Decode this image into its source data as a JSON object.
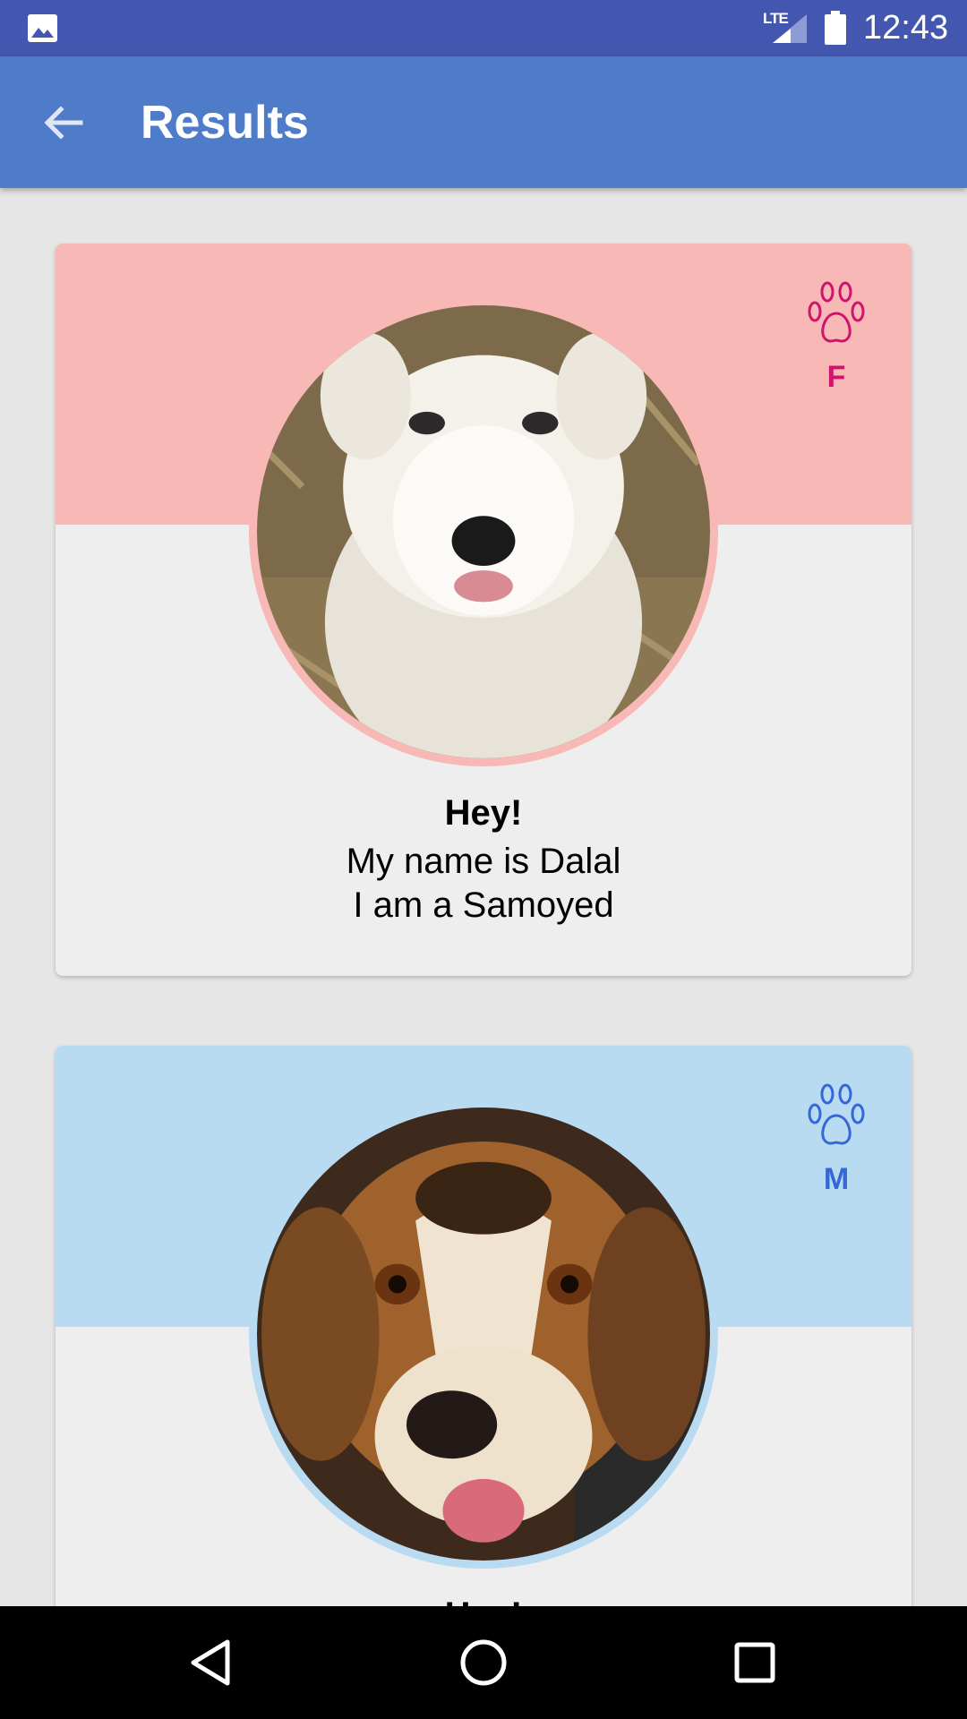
{
  "status_bar": {
    "network": "LTE",
    "time": "12:43",
    "icons": [
      "gallery-icon",
      "signal-icon",
      "battery-icon"
    ]
  },
  "app_bar": {
    "title": "Results",
    "back_icon": "arrow-back-icon"
  },
  "cards": [
    {
      "gender": "F",
      "greeting": "Hey!",
      "name_line": "My name is Dalal",
      "breed_line": "I am a Samoyed",
      "banner_color": "#f8b8b6",
      "accent_color": "#d0136c",
      "icon": "paw-icon"
    },
    {
      "gender": "M",
      "greeting": "Hey!",
      "banner_color": "#b9dbf2",
      "accent_color": "#3567d8",
      "icon": "paw-icon"
    }
  ],
  "nav_bar": {
    "icons": [
      "back-triangle-icon",
      "home-circle-icon",
      "recents-square-icon"
    ]
  },
  "colors": {
    "status_bar": "#4457b0",
    "app_bar": "#4f7cc9",
    "background": "#e6e6e6"
  }
}
